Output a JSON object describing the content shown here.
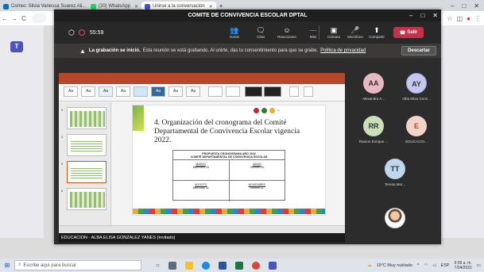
{
  "browser": {
    "tabs": [
      {
        "label": "Correo: Silvia Vanessa Suarez Ali...",
        "color": "#0f6cbd",
        "active": false
      },
      {
        "label": "(20) WhatsApp",
        "color": "#25d366",
        "active": false
      },
      {
        "label": "Unirse a la conversación",
        "color": "#4b53bc",
        "active": true
      }
    ],
    "new_tab": "+",
    "nav": {
      "back": "←",
      "forward": "→",
      "reload": "C"
    },
    "window_controls": {
      "minimize": "–",
      "maximize": "□",
      "close": "✕"
    }
  },
  "meeting": {
    "title": "COMITE DE CONVIVENCIA ESCOLAR DPTAL",
    "window_controls": {
      "minimize": "–",
      "maximize": "□",
      "close": "✕"
    },
    "timer": "55:59",
    "toolbar": [
      {
        "icon": "people",
        "glyph": "👥",
        "label": "Gente"
      },
      {
        "icon": "chat",
        "glyph": "🗨",
        "label": "Chat"
      },
      {
        "icon": "reactions",
        "glyph": "☺",
        "label": "Reacciones"
      },
      {
        "icon": "more",
        "glyph": "···",
        "label": "Más"
      }
    ],
    "toolbar_media": [
      {
        "icon": "camera",
        "glyph": "▣",
        "label": "Cámara"
      },
      {
        "icon": "microphone",
        "glyph": "🎤",
        "label": "Micrófono"
      },
      {
        "icon": "share",
        "glyph": "⬆",
        "label": "Compartir"
      }
    ],
    "leave_label": "Salir",
    "recording_banner": {
      "strong": "La grabación se inició.",
      "text": "Esta reunión se está grabando. Al unirte, das tu consentimiento para que se grabe.",
      "link": "Política de privacidad",
      "reject": "Descartar"
    },
    "presenter_label": "EDUCACION - ALBA ELISA GONZALEZ YANES (Invitado)"
  },
  "slide": {
    "title": "4. Organización del cronograma del Comité Departamental de Convivencia Escolar vigencia 2022.",
    "schedule_header_1": "PROPUESTA CRONOGRAMA AÑO 2022",
    "schedule_header_2": "COMITÉ DEPARTAMENTAL DE CONVIVENCIA ESCOLAR",
    "rows": [
      [
        {
          "month": "MARZO",
          "date": "Miércoles 23"
        },
        {
          "month": "JUNIO",
          "date": "Viernes 03"
        }
      ],
      [
        {
          "month": "AGOSTO",
          "date": "Miércoles 31"
        },
        {
          "month": "NOVIEMBRE",
          "date": "Viernes 11"
        }
      ]
    ]
  },
  "participants": [
    {
      "initials": "AA",
      "name": "Alexandra A...",
      "style": "av-pink"
    },
    {
      "initials": "AY",
      "name": "Alba Elisa Gonz...",
      "style": "av-purple"
    },
    {
      "initials": "RR",
      "name": "Ramon Enrique ...",
      "style": "av-green"
    },
    {
      "initials": "E",
      "name": "EDUCACIO...",
      "style": "av-peach"
    },
    {
      "initials": "TT",
      "name": "Teresa Mor...",
      "style": "av-blue"
    },
    {
      "initials": "",
      "name": "",
      "style": "av-photo"
    }
  ],
  "taskbar": {
    "search_placeholder": "Escribe aquí para buscar",
    "weather": "19°C Muy nublado",
    "language": "ESP",
    "time": "9:09 a. m.",
    "date": "7/04/2022"
  }
}
